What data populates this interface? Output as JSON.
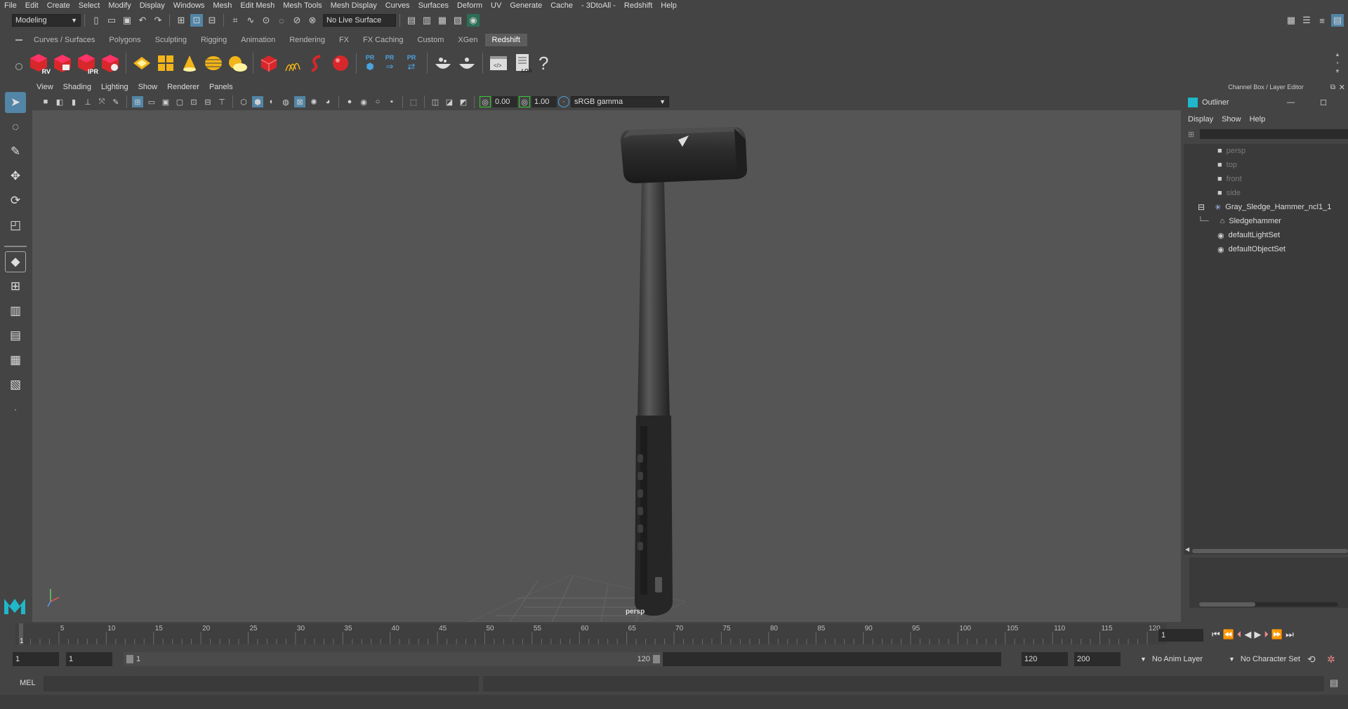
{
  "menubar": {
    "items": [
      "File",
      "Edit",
      "Create",
      "Select",
      "Modify",
      "Display",
      "Windows",
      "Mesh",
      "Edit Mesh",
      "Mesh Tools",
      "Mesh Display",
      "Curves",
      "Surfaces",
      "Deform",
      "UV",
      "Generate",
      "Cache",
      "- 3DtoAll -",
      "Redshift",
      "Help"
    ]
  },
  "status": {
    "mode": "Modeling",
    "live_surface": "No Live Surface"
  },
  "shelf": {
    "tabs": [
      "Curves / Surfaces",
      "Polygons",
      "Sculpting",
      "Rigging",
      "Animation",
      "Rendering",
      "FX",
      "FX Caching",
      "Custom",
      "XGen",
      "Redshift"
    ],
    "active_tab": "Redshift",
    "rv_label": "RV",
    "ipr_label": "IPR",
    "pr_labels": [
      "PR",
      "PR",
      "PR"
    ],
    "log_label": "LOG",
    "help_glyph": "?"
  },
  "panel_menu": [
    "View",
    "Shading",
    "Lighting",
    "Show",
    "Renderer",
    "Panels"
  ],
  "viewport_toolbar": {
    "exposure": "0.00",
    "gamma": "1.00",
    "colorspace": "sRGB gamma"
  },
  "viewport": {
    "camera_label": "persp"
  },
  "channel_box": {
    "title": "Channel Box / Layer Editor"
  },
  "outliner": {
    "title": "Outliner",
    "menu": [
      "Display",
      "Show",
      "Help"
    ],
    "items": [
      {
        "label": "persp",
        "type": "camera",
        "indent": 0,
        "dim": true
      },
      {
        "label": "top",
        "type": "camera",
        "indent": 0,
        "dim": true
      },
      {
        "label": "front",
        "type": "camera",
        "indent": 0,
        "dim": true
      },
      {
        "label": "side",
        "type": "camera",
        "indent": 0,
        "dim": true
      },
      {
        "label": "Gray_Sledge_Hammer_ncl1_1",
        "type": "group",
        "indent": 0,
        "dim": false
      },
      {
        "label": "Sledgehammer",
        "type": "mesh",
        "indent": 1,
        "dim": false
      },
      {
        "label": "defaultLightSet",
        "type": "set",
        "indent": 0,
        "dim": false
      },
      {
        "label": "defaultObjectSet",
        "type": "set",
        "indent": 0,
        "dim": false
      }
    ]
  },
  "timeline": {
    "start": 1,
    "end": 120,
    "ticks": [
      5,
      10,
      15,
      20,
      25,
      30,
      35,
      40,
      45,
      50,
      55,
      60,
      65,
      70,
      75,
      80,
      85,
      90,
      95,
      100,
      105,
      110,
      115,
      120
    ],
    "current_frame_label": "1",
    "current_frame": "1"
  },
  "range": {
    "start_field": "1",
    "playback_start": "1",
    "slider_start": "1",
    "slider_end": "120",
    "playback_end": "120",
    "end_field": "200",
    "anim_layer": "No Anim Layer",
    "character_set": "No Character Set"
  },
  "command": {
    "lang": "MEL"
  },
  "colors": {
    "accent": "#5285a6",
    "redshift_red": "#d8272b",
    "maya_teal": "#1fb7c9",
    "shelf_yellow": "#f2b418"
  }
}
